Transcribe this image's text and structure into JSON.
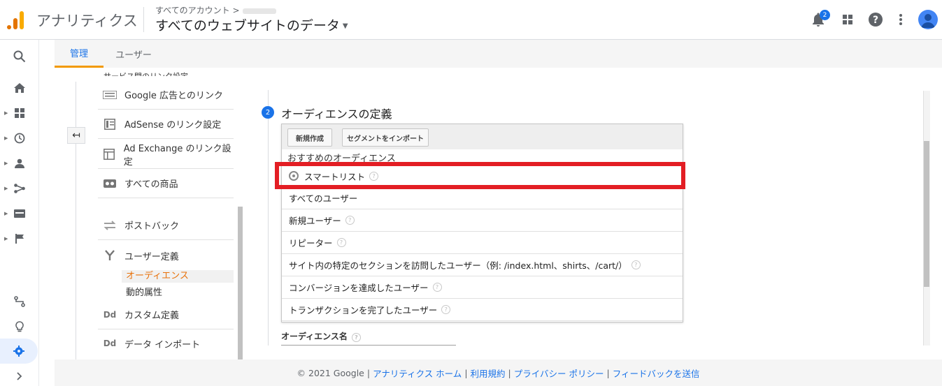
{
  "header": {
    "app_name": "アナリティクス",
    "breadcrumb": "すべてのアカウント >",
    "view_title": "すべてのウェブサイトのデータ",
    "notification_count": "2"
  },
  "tabs": [
    {
      "label": "管理",
      "active": true
    },
    {
      "label": "ユーザー",
      "active": false
    }
  ],
  "admin_menu": {
    "cut_title": "サービス間のリンク設定",
    "items": [
      {
        "label": "Google 広告とのリンク",
        "icon": "google-ads-icon"
      },
      {
        "label": "AdSense のリンク設定",
        "icon": "adsense-icon"
      },
      {
        "label": "Ad Exchange のリンク設定",
        "icon": "ad-exchange-icon"
      },
      {
        "label": "すべての商品",
        "icon": "products-icon"
      },
      {
        "label": "ポストバック",
        "icon": "postback-icon"
      },
      {
        "label": "ユーザー定義",
        "icon": "user-definition-icon"
      },
      {
        "label": "カスタム定義",
        "icon": "dd-icon",
        "icon_text": "Dd"
      },
      {
        "label": "データ インポート",
        "icon": "dd-icon",
        "icon_text": "Dd"
      }
    ],
    "sub_active": "オーディエンス",
    "sub_item": "動的属性"
  },
  "step": {
    "number": "2",
    "title": "オーディエンスの定義"
  },
  "dropdown": {
    "buttons": [
      "新規作成",
      "セグメントをインポート"
    ],
    "section_title": "おすすめのオーディエンス",
    "rows": [
      "スマートリスト",
      "すべてのユーザー",
      "新規ユーザー",
      "リピーター",
      "サイト内の特定のセクションを訪問したユーザー（例: /index.html、shirts、/cart/）",
      "コンバージョンを達成したユーザー",
      "トランザクションを完了したユーザー"
    ],
    "help_glyph": "?"
  },
  "audience_name_label": "オーディエンス名",
  "footer": {
    "copyright": "© 2021 Google",
    "links": [
      "アナリティクス ホーム",
      "利用規約",
      "プライバシー ポリシー",
      "フィードバックを送信"
    ],
    "separator": "|"
  },
  "colors": {
    "accent": "#1a73e8",
    "active_tab_underline": "#f29900",
    "highlight_box": "#e31e24",
    "active_sub_item": "#e8710a"
  }
}
